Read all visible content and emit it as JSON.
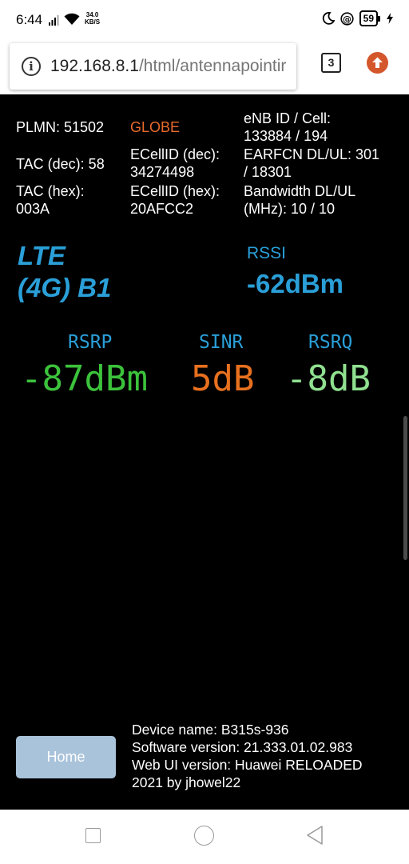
{
  "status_bar": {
    "time": "6:44",
    "net_speed_value": "34.0",
    "net_speed_unit": "KB/S",
    "battery": "59"
  },
  "browser": {
    "url_host": "192.168.8.1",
    "url_path": "/html/antennapointir",
    "tab_count": "3"
  },
  "cell_info": {
    "plmn": "PLMN: 51502",
    "operator": "GLOBE",
    "enb_cell_label": "eNB ID / Cell:",
    "enb_cell_value": "133884 / 194",
    "tac_dec": "TAC (dec): 58",
    "ecellid_dec_label": "ECellID (dec):",
    "ecellid_dec_value": "34274498",
    "earfcn_label": "EARFCN DL/UL: 301",
    "earfcn_value": "/ 18301",
    "tac_hex_label": "TAC (hex):",
    "tac_hex_value": "003A",
    "ecellid_hex_label": "ECellID (hex):",
    "ecellid_hex_value": "20AFCC2",
    "bandwidth_label": "Bandwidth DL/UL",
    "bandwidth_value": "(MHz): 10 / 10"
  },
  "band": {
    "line1": "LTE",
    "line2": "(4G) B1"
  },
  "rssi": {
    "label": "RSSI",
    "value": "-62dBm"
  },
  "metrics": {
    "rsrp": {
      "label": "RSRP",
      "value": "-87dBm",
      "color": "#3cc23c"
    },
    "sinr": {
      "label": "SINR",
      "value": "5dB",
      "color": "#e8701e"
    },
    "rsrq": {
      "label": "RSRQ",
      "value": "-8dB",
      "color": "#8fe08f"
    }
  },
  "footer": {
    "home_label": "Home",
    "device_name": "Device name: B315s-936",
    "software_version": "Software version: 21.333.01.02.983",
    "webui_version": "Web UI version: Huawei RELOADED",
    "webui_credit": "2021 by jhowel22"
  },
  "colors": {
    "accent_blue": "#2a9fd8",
    "operator_orange": "#e96a2c",
    "home_button": "#a9c3da"
  },
  "icons": {
    "status": [
      "signal-icon",
      "wifi-icon",
      "moon-icon",
      "at-icon",
      "battery-icon",
      "charging-icon"
    ],
    "browser": [
      "info-icon",
      "tab-switcher-icon",
      "update-icon"
    ],
    "nav": [
      "recents-icon",
      "home-icon",
      "back-icon"
    ]
  }
}
